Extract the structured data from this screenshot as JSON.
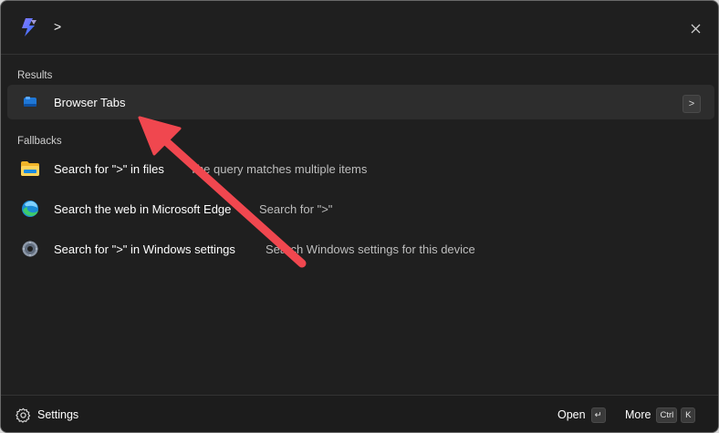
{
  "search": {
    "query": ">"
  },
  "sections": {
    "results_label": "Results",
    "fallbacks_label": "Fallbacks"
  },
  "results": [
    {
      "title": "Browser Tabs",
      "action_glyph": ">",
      "icon": "browser-tabs-icon"
    }
  ],
  "fallbacks": [
    {
      "title": "Search for \">\" in files",
      "subtitle": "The query matches multiple items",
      "icon": "file-explorer-folder-icon"
    },
    {
      "title": "Search the web in Microsoft Edge",
      "subtitle": "Search for \">\"",
      "icon": "edge-web-icon"
    },
    {
      "title": "Search for \">\" in Windows settings",
      "subtitle": "Search Windows settings for this device",
      "icon": "windows-settings-gear-icon"
    }
  ],
  "footer": {
    "settings_label": "Settings",
    "open_label": "Open",
    "open_key": "↵",
    "more_label": "More",
    "more_key_1": "Ctrl",
    "more_key_2": "K"
  },
  "colors": {
    "background": "#1f1f1f",
    "selected_row": "#2d2d2d",
    "accent_logo": "#5b6cff",
    "annotation_arrow": "#f0474f"
  }
}
